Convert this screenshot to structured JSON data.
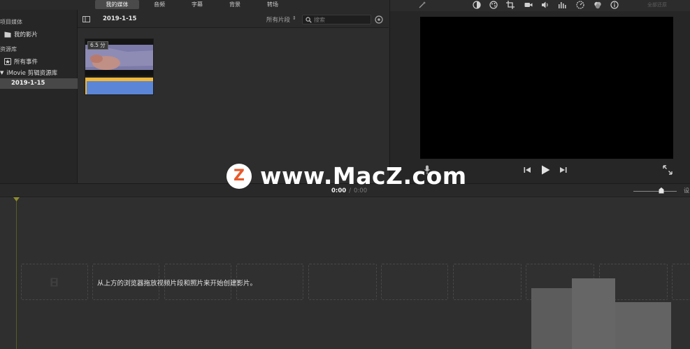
{
  "tabs": {
    "my_media": "我的媒体",
    "audio": "音频",
    "titles": "字幕",
    "backgrounds": "背景",
    "transitions": "转场"
  },
  "sidebar": {
    "project_media_heading": "项目媒体",
    "my_movie": "我的影片",
    "library_heading": "资源库",
    "all_events": "所有事件",
    "library_name": "iMovie 剪辑资源库",
    "event_date": "2019-1-15"
  },
  "browser": {
    "event_title": "2019-1-15",
    "filter_label": "所有片段",
    "search_placeholder": "搜索",
    "clip_duration": "6.5 分"
  },
  "viewer": {
    "top_right_label": "全部还原"
  },
  "timeline": {
    "time_current": "0:00",
    "time_separator": "/",
    "time_total": "0:00",
    "settings_label": "设",
    "empty_hint": "从上方的浏览器拖放视频片段和照片来开始创建影片。"
  },
  "watermark": {
    "logo_letter": "Z",
    "text": "www.MacZ.com"
  },
  "colors": {
    "accent_orange": "#e8592b",
    "clip_yellow": "#f2b733",
    "clip_blue": "#5b85d6"
  }
}
